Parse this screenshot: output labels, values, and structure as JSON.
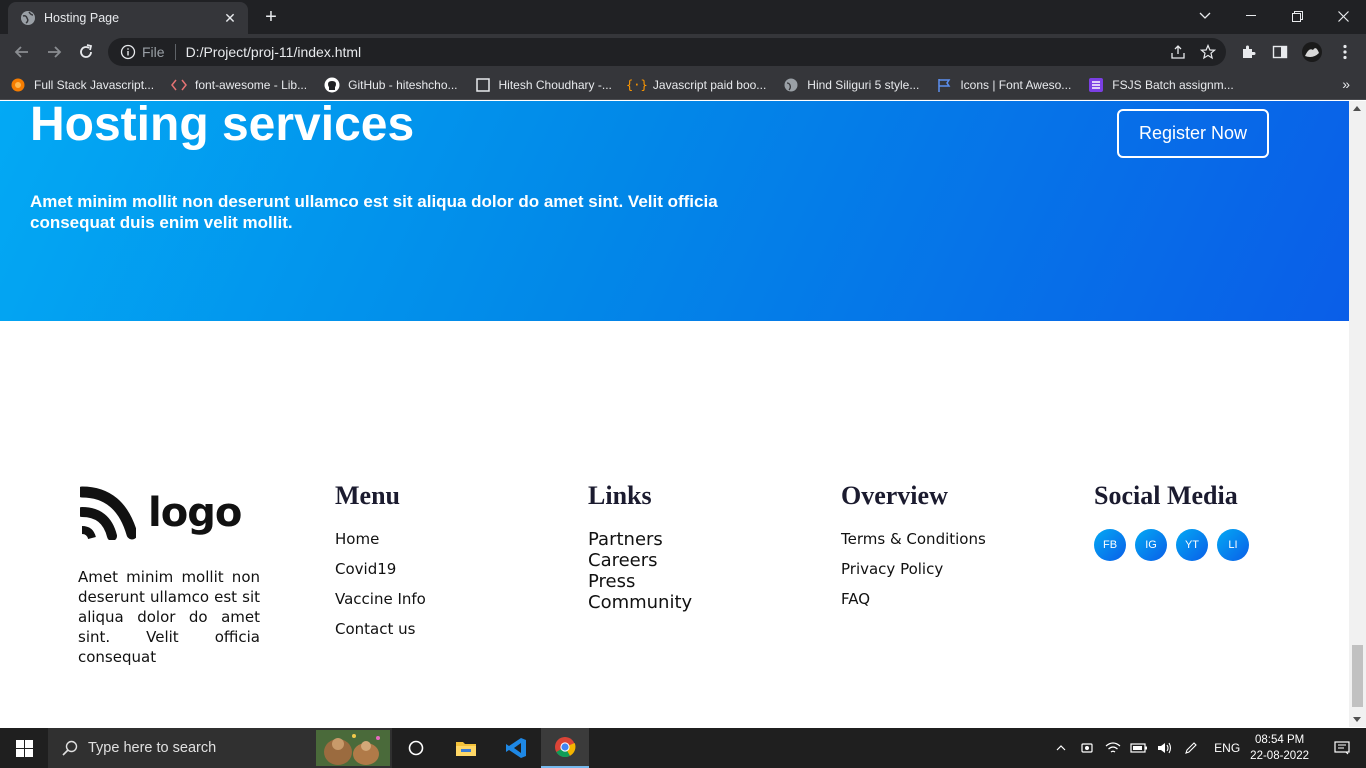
{
  "browser": {
    "tab_title": "Hosting Page",
    "scheme_label": "File",
    "url": "D:/Project/proj-11/index.html",
    "bookmarks": [
      {
        "label": "Full Stack Javascript...",
        "icon": "orange-circle-icon"
      },
      {
        "label": "font-awesome - Lib...",
        "icon": "code-brackets-icon"
      },
      {
        "label": "GitHub - hiteshcho...",
        "icon": "github-icon"
      },
      {
        "label": "Hitesh Choudhary -...",
        "icon": "page-icon"
      },
      {
        "label": "Javascript paid boo...",
        "icon": "curly-braces-icon"
      },
      {
        "label": "Hind Siliguri 5 style...",
        "icon": "globe-icon"
      },
      {
        "label": "Icons | Font Aweso...",
        "icon": "flag-icon"
      },
      {
        "label": "FSJS Batch assignm...",
        "icon": "list-icon"
      }
    ]
  },
  "hero": {
    "title": "Hosting services",
    "description": "Amet minim mollit non deserunt ullamco est sit aliqua dolor do amet sint. Velit officia consequat duis enim velit mollit.",
    "register_label": "Register Now"
  },
  "footer": {
    "logo_text": "logo",
    "description": "Amet minim mollit non deserunt ullamco est sit aliqua dolor do amet sint. Velit officia consequat",
    "menu": {
      "title": "Menu",
      "items": [
        "Home",
        "Covid19",
        "Vaccine Info",
        "Contact us"
      ]
    },
    "links": {
      "title": "Links",
      "items": [
        "Partners",
        "Careers",
        "Press",
        "Community"
      ]
    },
    "overview": {
      "title": "Overview",
      "items": [
        "Terms & Conditions",
        "Privacy Policy",
        "FAQ"
      ]
    },
    "social": {
      "title": "Social Media",
      "items": [
        "FB",
        "IG",
        "YT",
        "LI"
      ]
    }
  },
  "taskbar": {
    "search_placeholder": "Type here to search",
    "lang": "ENG",
    "time": "08:54 PM",
    "date": "22-08-2022"
  },
  "colors": {
    "hero_gradient_start": "#03a9f4",
    "hero_gradient_end": "#0a5ee8",
    "heading": "#1b1b2f"
  }
}
